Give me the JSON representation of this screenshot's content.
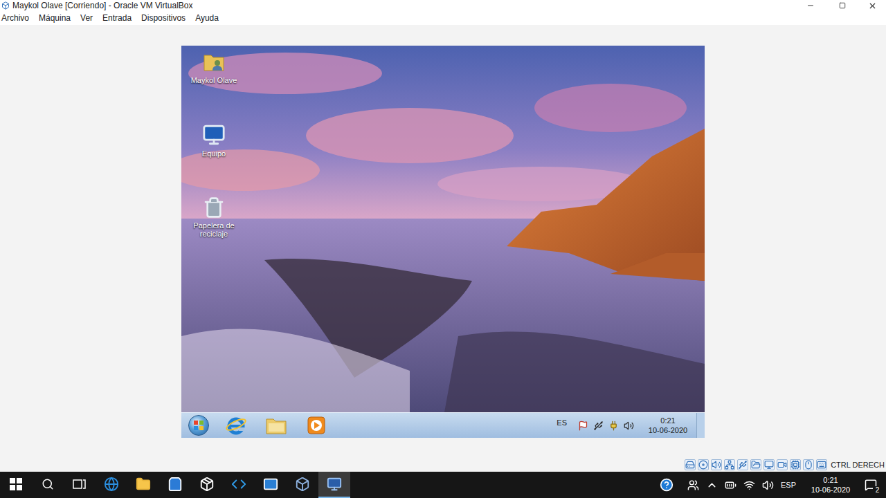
{
  "window": {
    "title": "Maykol Olave [Corriendo] - Oracle VM VirtualBox"
  },
  "menu": [
    {
      "label": "Archivo"
    },
    {
      "label": "Máquina"
    },
    {
      "label": "Ver"
    },
    {
      "label": "Entrada"
    },
    {
      "label": "Dispositivos"
    },
    {
      "label": "Ayuda"
    }
  ],
  "guest": {
    "desktop_icons": [
      {
        "label": "Maykol Olave",
        "kind": "user-folder"
      },
      {
        "label": "Equipo",
        "kind": "computer"
      },
      {
        "label": "Papelera de reciclaje",
        "kind": "recycle-bin"
      }
    ],
    "taskbar": {
      "pinned": [
        {
          "kind": "ie"
        },
        {
          "kind": "explorer"
        },
        {
          "kind": "media-player"
        }
      ],
      "language": "ES",
      "tray": [
        {
          "kind": "action-center"
        },
        {
          "kind": "device"
        },
        {
          "kind": "power"
        },
        {
          "kind": "volume"
        }
      ],
      "time": "0:21",
      "date": "10-06-2020"
    }
  },
  "status_bar": {
    "device_icons": [
      {
        "kind": "hdd"
      },
      {
        "kind": "optical"
      },
      {
        "kind": "audio"
      },
      {
        "kind": "network"
      },
      {
        "kind": "usb"
      },
      {
        "kind": "shared-folder"
      },
      {
        "kind": "display"
      },
      {
        "kind": "recording"
      },
      {
        "kind": "cpu"
      },
      {
        "kind": "mouse"
      },
      {
        "kind": "keyboard"
      }
    ],
    "host_key": "CTRL DERECH"
  },
  "host_taskbar": {
    "apps": [
      {
        "kind": "start",
        "selected": false
      },
      {
        "kind": "search",
        "selected": false
      },
      {
        "kind": "taskview",
        "selected": false
      },
      {
        "kind": "edge",
        "selected": false
      },
      {
        "kind": "explorer",
        "selected": false
      },
      {
        "kind": "store",
        "selected": false
      },
      {
        "kind": "dropbox",
        "selected": false
      },
      {
        "kind": "vscode",
        "selected": false
      },
      {
        "kind": "mail",
        "selected": false
      },
      {
        "kind": "virtualbox",
        "selected": false
      },
      {
        "kind": "vbox-vm",
        "selected": true
      }
    ],
    "tray": [
      {
        "kind": "help"
      },
      {
        "kind": "people"
      },
      {
        "kind": "show-hidden"
      },
      {
        "kind": "battery"
      },
      {
        "kind": "wifi"
      },
      {
        "kind": "volume"
      }
    ],
    "language": "ESP",
    "time": "0:21",
    "date": "10-06-2020",
    "notifications": "2"
  }
}
